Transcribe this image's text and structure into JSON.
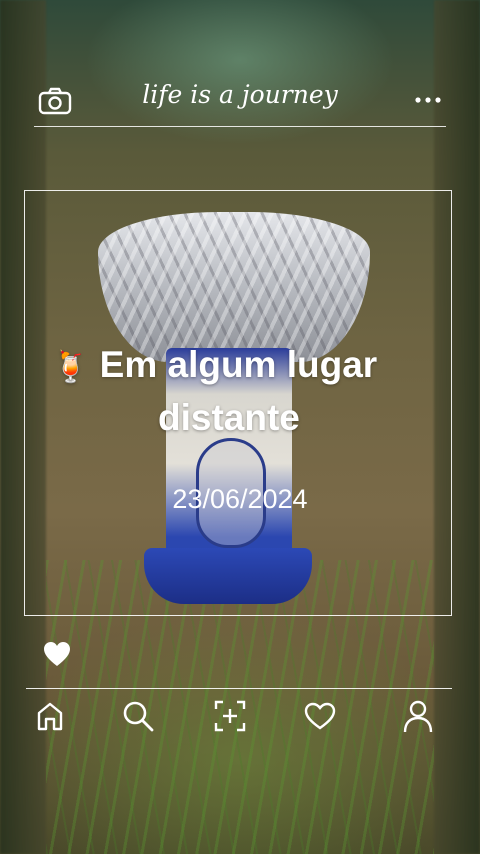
{
  "header": {
    "title": "life is a journey",
    "camera_icon": "camera-icon",
    "more_icon": "more-dots-icon"
  },
  "post": {
    "emoji": "🍹",
    "title_line1": "Em algum lugar",
    "title_line2": "distante",
    "date": "23/06/2024",
    "like_icon": "heart-filled-icon"
  },
  "nav": {
    "items": [
      {
        "icon": "home-icon"
      },
      {
        "icon": "search-icon"
      },
      {
        "icon": "add-photo-icon"
      },
      {
        "icon": "heart-icon"
      },
      {
        "icon": "profile-icon"
      }
    ]
  },
  "colors": {
    "overlay_text": "#ffffff",
    "frame_line": "#ffffff"
  }
}
